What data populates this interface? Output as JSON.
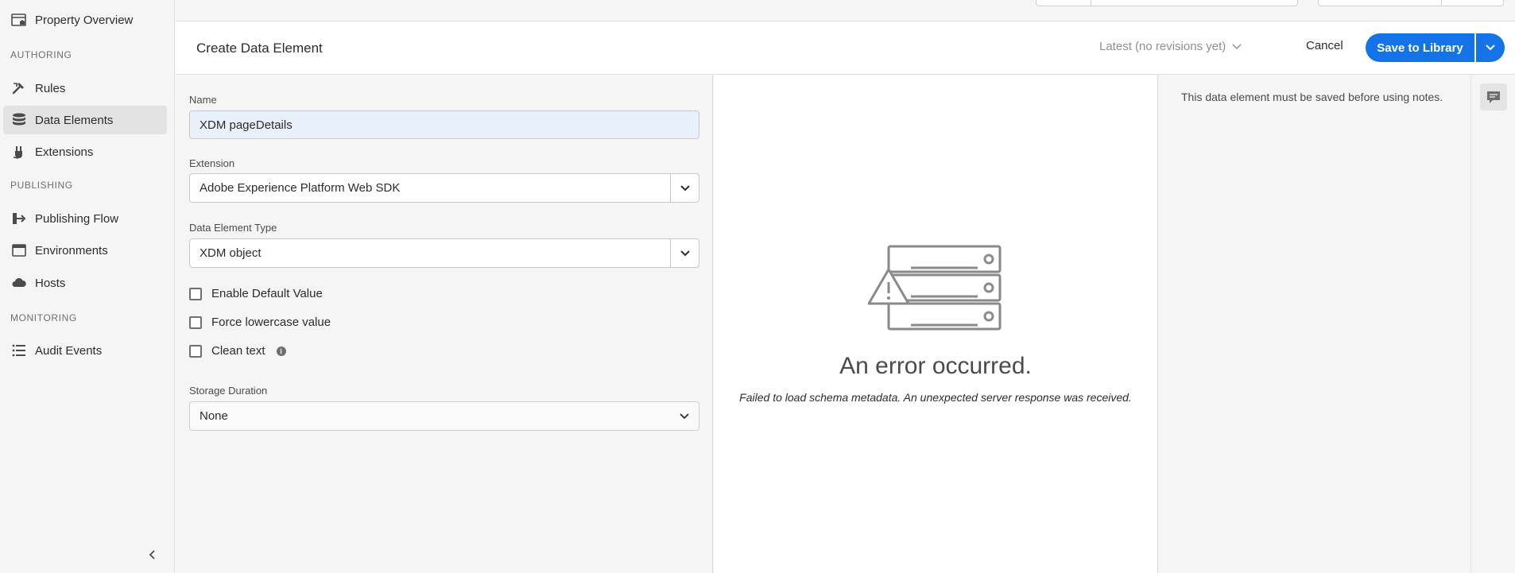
{
  "sidebar": {
    "top_item": {
      "label": "Property Overview",
      "icon": "property-overview-icon"
    },
    "sections": {
      "authoring": "AUTHORING",
      "publishing": "PUBLISHING",
      "monitoring": "MONITORING"
    },
    "items": [
      {
        "label": "Rules",
        "icon": "rules-icon"
      },
      {
        "label": "Data Elements",
        "icon": "data-elements-icon",
        "selected": true
      },
      {
        "label": "Extensions",
        "icon": "extensions-icon"
      },
      {
        "label": "Publishing Flow",
        "icon": "publishing-flow-icon"
      },
      {
        "label": "Environments",
        "icon": "environments-icon"
      },
      {
        "label": "Hosts",
        "icon": "hosts-icon"
      },
      {
        "label": "Audit Events",
        "icon": "audit-events-icon"
      }
    ]
  },
  "header": {
    "title": "Create Data Element",
    "revisions": "Latest (no revisions yet)",
    "cancel": "Cancel",
    "save": "Save to Library"
  },
  "form": {
    "name_label": "Name",
    "name_value": "XDM pageDetails",
    "extension_label": "Extension",
    "extension_value": "Adobe Experience Platform Web SDK",
    "type_label": "Data Element Type",
    "type_value": "XDM object",
    "checkboxes": [
      {
        "label": "Enable Default Value",
        "checked": false
      },
      {
        "label": "Force lowercase value",
        "checked": false
      },
      {
        "label": "Clean text",
        "checked": false
      }
    ],
    "storage_label": "Storage Duration",
    "storage_value": "None"
  },
  "error": {
    "title": "An error occurred.",
    "description": "Failed to load schema metadata. An unexpected server response was received."
  },
  "notes": {
    "message": "This data element must be saved before using notes."
  },
  "colors": {
    "accent": "#1473e6",
    "selected_nav": "#e3e3e3",
    "input_highlight": "#e8f0fc"
  }
}
